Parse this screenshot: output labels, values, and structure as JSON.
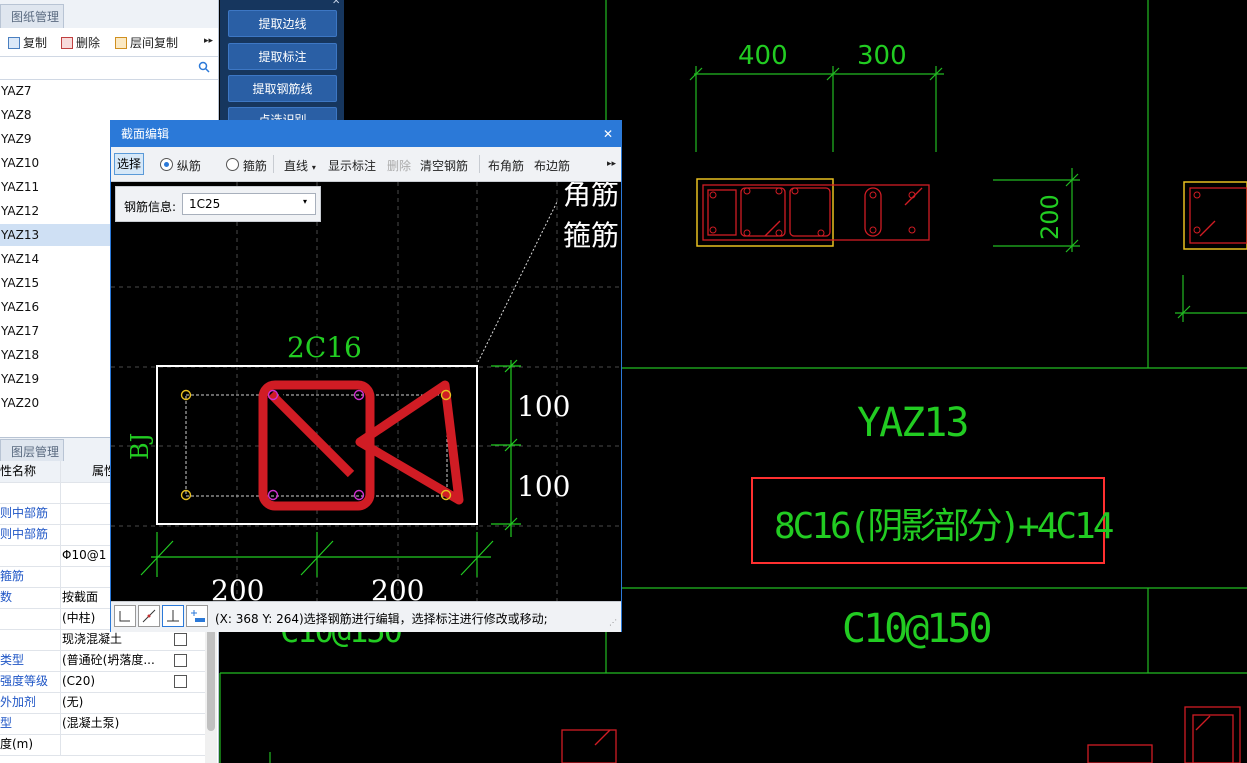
{
  "left_panel": {
    "drawing_tab": "图纸管理",
    "toolbar": {
      "copy": "复制",
      "delete": "删除",
      "floor_copy": "层间复制",
      "more": "▸▸"
    },
    "items": [
      "YAZ7",
      "YAZ8",
      "YAZ9",
      "YAZ10",
      "YAZ11",
      "YAZ12",
      "YAZ13",
      "YAZ14",
      "YAZ15",
      "YAZ16",
      "YAZ17",
      "YAZ18",
      "YAZ19",
      "YAZ20"
    ],
    "selected_item": "YAZ13",
    "layer_tab": "图层管理",
    "prop_header": {
      "name": "性名称",
      "value": "属性"
    },
    "props": [
      {
        "name": "",
        "value": "",
        "blue": false,
        "cb": false
      },
      {
        "name": "则中部筋",
        "value": "",
        "blue": true,
        "cb": false
      },
      {
        "name": "则中部筋",
        "value": "",
        "blue": true,
        "cb": false
      },
      {
        "name": "",
        "value": "Φ10@1",
        "blue": false,
        "cb": false
      },
      {
        "name": "箍筋",
        "value": "",
        "blue": true,
        "cb": false
      },
      {
        "name": "数",
        "value": "按截面",
        "blue": true,
        "cb": false
      },
      {
        "name": "",
        "value": "(中柱)",
        "blue": false,
        "cb": false
      },
      {
        "name": "",
        "value": "现浇混凝土",
        "blue": false,
        "cb": true
      },
      {
        "name": "类型",
        "value": "(普通砼(坍落度...",
        "blue": true,
        "cb": true
      },
      {
        "name": "强度等级",
        "value": "(C20)",
        "blue": true,
        "cb": true
      },
      {
        "name": "外加剂",
        "value": "(无)",
        "blue": true,
        "cb": false
      },
      {
        "name": "型",
        "value": "(混凝土泵)",
        "blue": true,
        "cb": false
      },
      {
        "name": "度(m)",
        "value": "",
        "blue": false,
        "cb": false
      }
    ]
  },
  "blue_panel": {
    "buttons": [
      "提取边线",
      "提取标注",
      "提取钢筋线",
      "点选识别"
    ],
    "close": "✕"
  },
  "dialog": {
    "title": "截面编辑",
    "close": "✕",
    "toolbar": {
      "select": "选择",
      "radio_long": "纵筋",
      "radio_stirrup": "箍筋",
      "line": "直线",
      "show_dim": "显示标注",
      "delete": "删除",
      "clear": "清空钢筋",
      "corner": "布角筋",
      "edge": "布边筋",
      "more": "▸▸"
    },
    "rebar_info_label": "钢筋信息:",
    "rebar_info_value": "1C25",
    "canvas": {
      "top_label": "2C16",
      "side_label": "BJ",
      "dim_right_1": "100",
      "dim_right_2": "100",
      "dim_bottom_1": "200",
      "dim_bottom_2": "200",
      "overflow_text_1": "角筋",
      "overflow_text_2": "箍筋"
    },
    "status_text": "(X: 368 Y: 264)选择钢筋进行编辑，选择标注进行修改或移动;"
  },
  "cad": {
    "dim_top_1": "400",
    "dim_top_2": "300",
    "dim_side": "200",
    "column_name": "YAZ13",
    "rebar_text": "8C16(阴影部分)+4C14",
    "stirrup_text": "C10@150",
    "stirrup_text_ghost": "C10@150"
  },
  "colors": {
    "cad_green": "#22cc22",
    "rebar_red": "#d01c24",
    "highlight_yellow": "#e8c020",
    "title_blue": "#2b79d8"
  }
}
